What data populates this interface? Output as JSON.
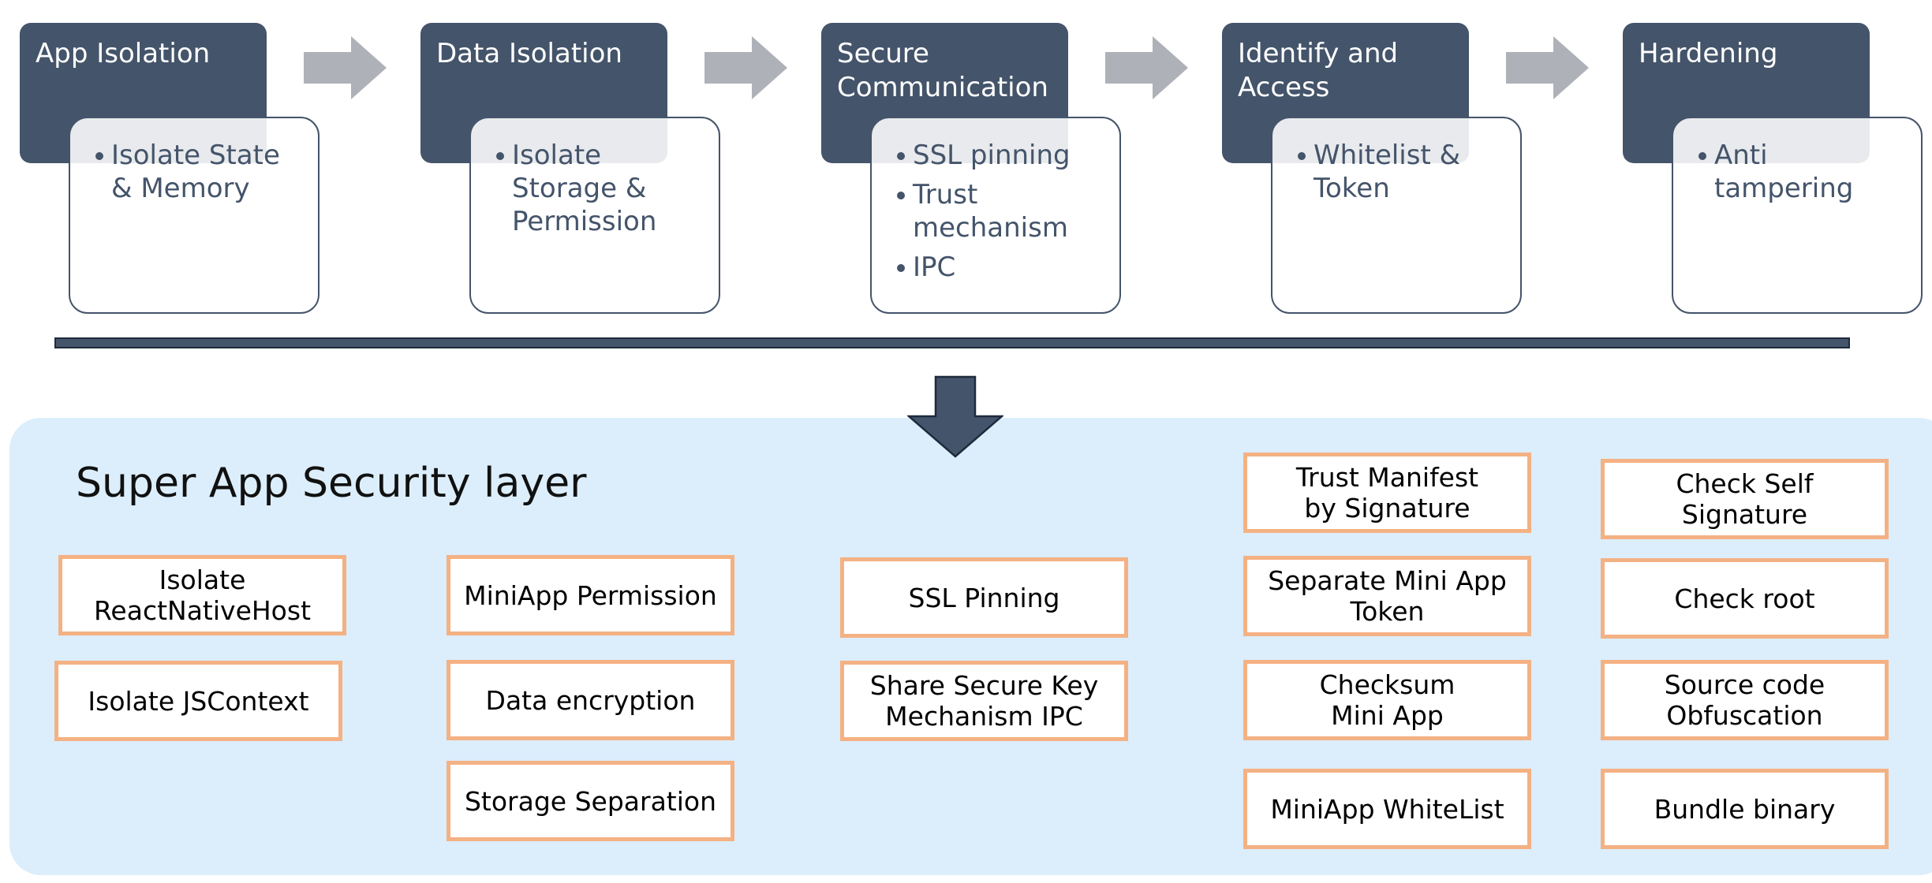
{
  "colors": {
    "stage_dark": "#44546a",
    "flow_arrow": "#aeb2b8",
    "panel_bg": "#dceefb",
    "box_border": "#f4b183"
  },
  "stages": [
    {
      "title": "App Isolation",
      "items": [
        "Isolate State & Memory"
      ]
    },
    {
      "title": "Data Isolation",
      "items": [
        "Isolate Storage & Permission"
      ]
    },
    {
      "title": "Secure Communication",
      "items": [
        "SSL pinning",
        "Trust mechanism",
        "IPC"
      ]
    },
    {
      "title": "Identify and Access",
      "items": [
        "Whitelist & Token"
      ]
    },
    {
      "title": "Hardening",
      "items": [
        "Anti tampering"
      ]
    }
  ],
  "security_layer": {
    "title": "Super App Security layer",
    "columns": [
      [
        "Isolate ReactNativeHost",
        "Isolate JSContext"
      ],
      [
        "MiniApp Permission",
        "Data encryption",
        "Storage Separation"
      ],
      [
        "SSL Pinning",
        "Share Secure Key\nMechanism IPC"
      ],
      [
        "Trust Manifest\nby Signature",
        "Separate Mini App\nToken",
        "Checksum\nMini App",
        "MiniApp WhiteList"
      ],
      [
        "Check Self Signature",
        "Check root",
        "Source code\nObfuscation",
        "Bundle binary"
      ]
    ]
  }
}
